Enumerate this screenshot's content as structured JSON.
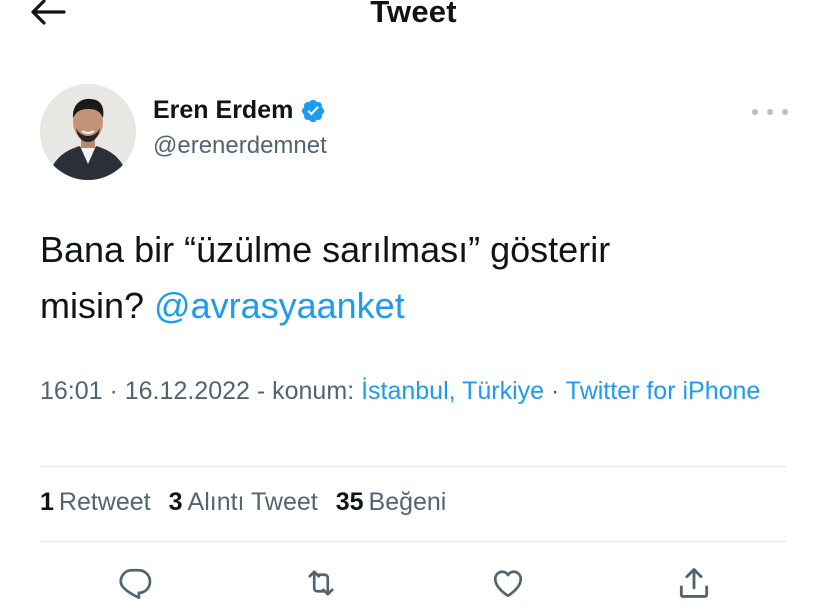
{
  "header": {
    "title": "Tweet"
  },
  "author": {
    "name": "Eren Erdem",
    "handle": "@erenerdemnet"
  },
  "tweet": {
    "text_line1": "Bana bir “üzülme sarılması” gösterir",
    "text_line2_prefix": "misin? ",
    "mention": "@avrasyaanket"
  },
  "meta": {
    "time": "16:01",
    "sep1": " · ",
    "date": "16.12.2022",
    "location_prefix": " - konum: ",
    "location": "İstanbul, Türkiye",
    "sep2": " · ",
    "source": "Twitter for iPhone"
  },
  "stats": [
    {
      "count": "1",
      "label": "Retweet"
    },
    {
      "count": "3",
      "label": "Alıntı Tweet"
    },
    {
      "count": "35",
      "label": "Beğeni"
    }
  ],
  "icons": {
    "back": "arrow-left-icon",
    "verified": "verified-badge-icon",
    "more": "more-dots-icon",
    "reply": "reply-icon",
    "retweet": "retweet-icon",
    "like": "like-heart-icon",
    "share": "share-icon"
  },
  "colors": {
    "accent": "#1d9bf0",
    "text": "#0f1419",
    "secondary": "#536471",
    "divider": "#e4e8eb"
  }
}
